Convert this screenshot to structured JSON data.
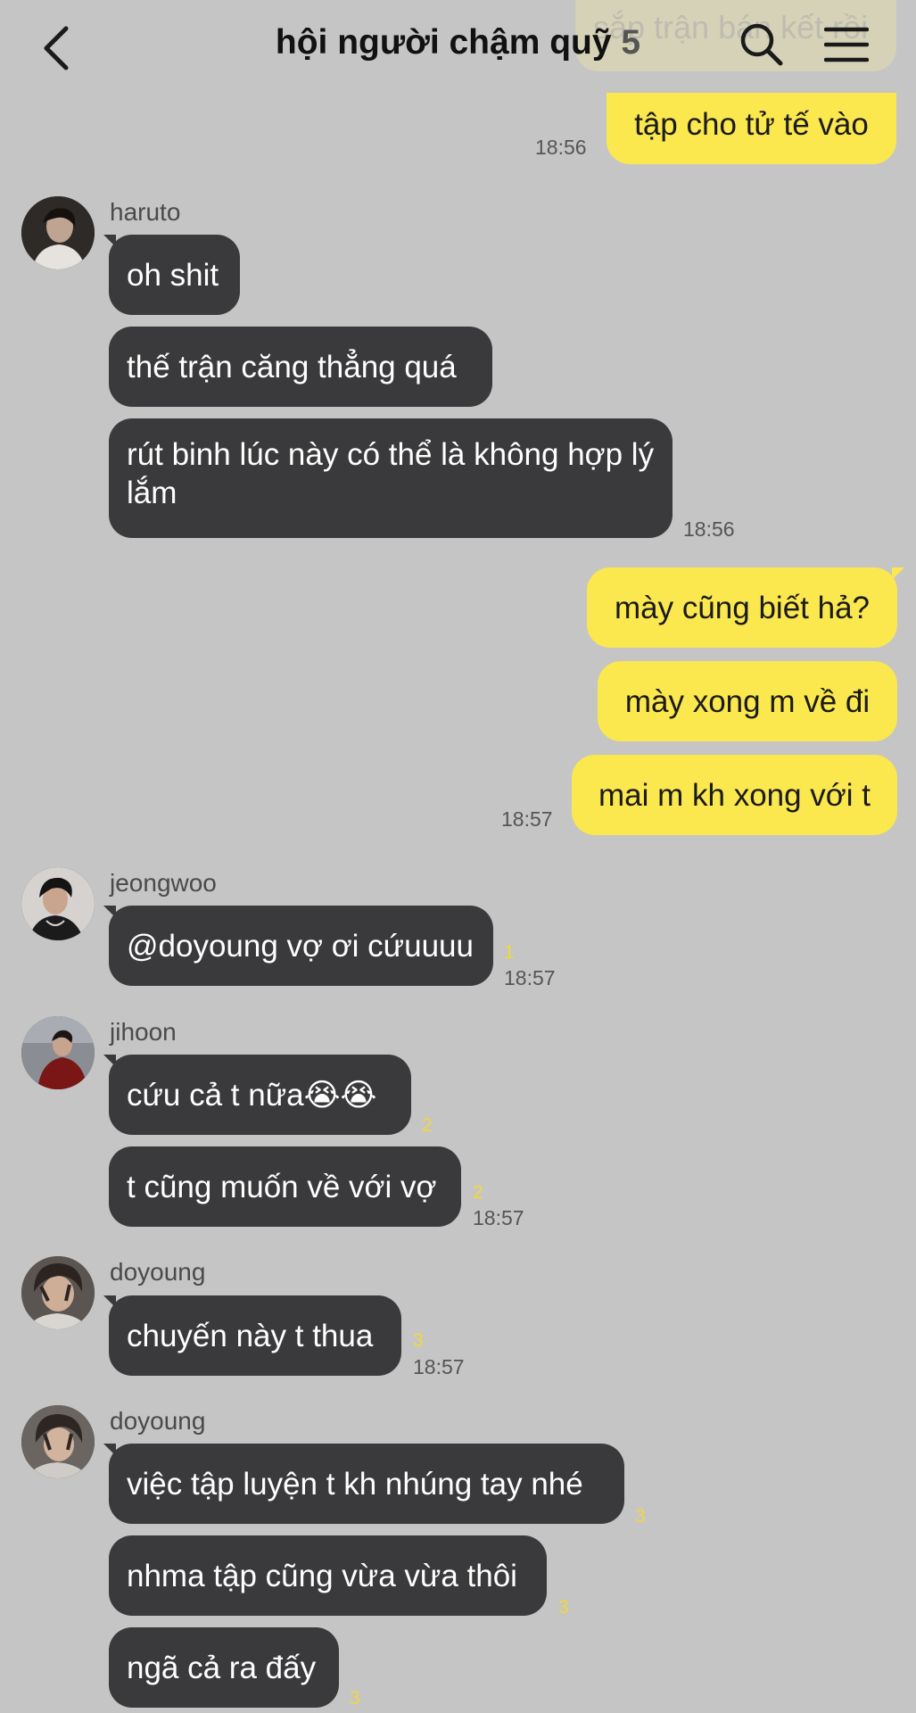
{
  "header": {
    "title": "hội người chậm quỹ",
    "member_count": "5",
    "background_preview": "sắp trận bán kết rồi"
  },
  "messages": {
    "m1": {
      "text": "tập cho tử tế vào",
      "time": "18:56"
    },
    "m2": {
      "sender": "haruto",
      "lines": [
        "oh shit",
        "thế trận căng thẳng quá",
        "rút binh lúc này có thể là không hợp lý lắm"
      ],
      "time": "18:56"
    },
    "m3": {
      "lines": [
        "mày cũng biết hả?",
        "mày xong m về đi",
        "mai m kh xong với t"
      ],
      "time": "18:57"
    },
    "m4": {
      "sender": "jeongwoo",
      "text": "@doyoung vợ ơi cứuuuu",
      "unread": "1",
      "time": "18:57"
    },
    "m5": {
      "sender": "jihoon",
      "lines": [
        "cứu cả t nữa😭😭",
        "t cũng muốn về với vợ"
      ],
      "unread": [
        "2",
        "2"
      ],
      "time": "18:57"
    },
    "m6": {
      "sender": "doyoung",
      "text": "chuyến này t thua",
      "unread": "3",
      "time": "18:57"
    },
    "m7": {
      "sender": "doyoung",
      "lines": [
        "việc tập luyện t kh nhúng tay nhé",
        "nhma tập cũng vừa vừa thôi",
        "ngã cả ra đấy"
      ],
      "unread": [
        "3",
        "3",
        "3"
      ]
    }
  },
  "colors": {
    "background": "#c5c5c5",
    "outgoing_bubble": "#fbe74e",
    "incoming_bubble": "#3a3a3c",
    "unread_count": "#f2d83b"
  },
  "icons": [
    "chevron-left-icon",
    "search-icon",
    "menu-icon"
  ]
}
